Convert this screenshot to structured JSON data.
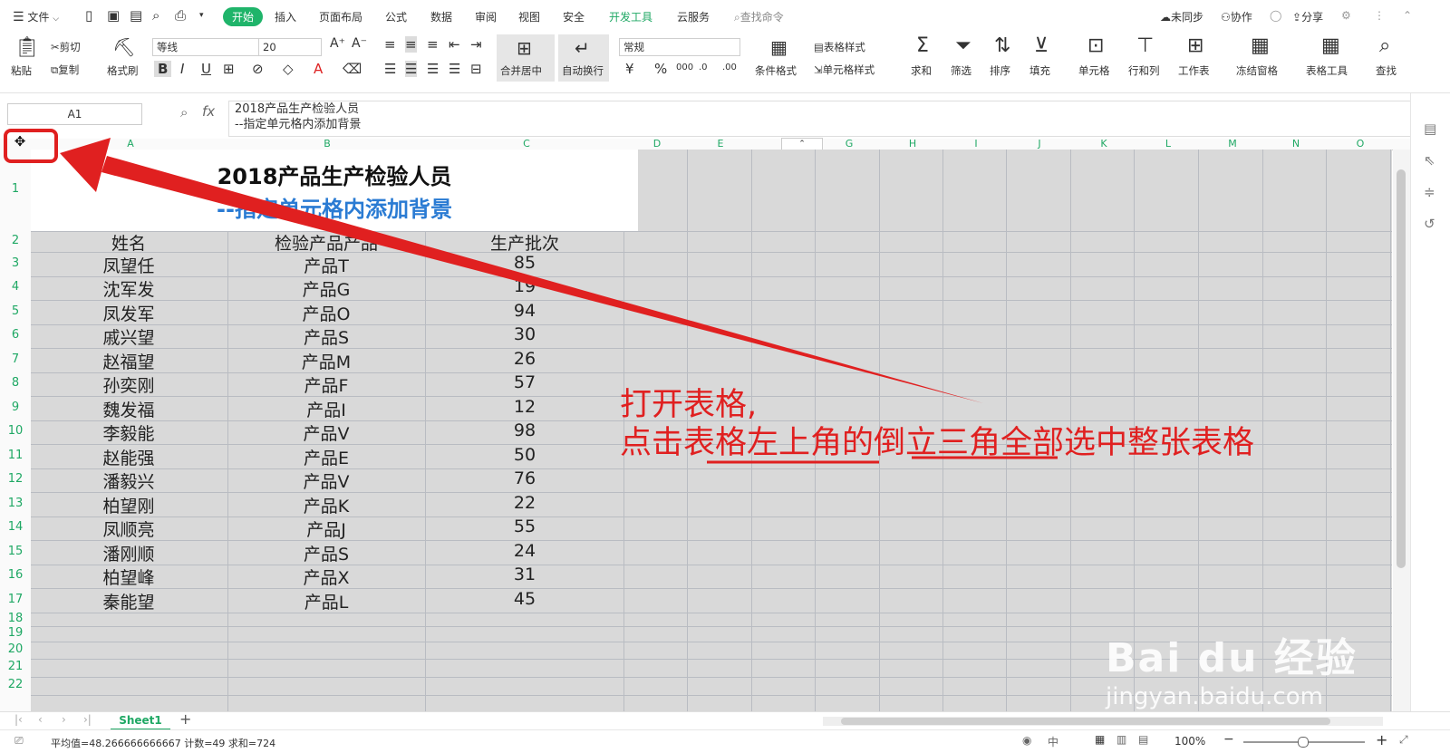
{
  "menu": {
    "file": "文件",
    "tabs": [
      "开始",
      "插入",
      "页面布局",
      "公式",
      "数据",
      "审阅",
      "视图",
      "安全",
      "开发工具",
      "云服务"
    ],
    "search": "查找命令",
    "right": [
      "未同步",
      "协作",
      "分享"
    ]
  },
  "ribbon": {
    "paste": "粘贴",
    "cut": "剪切",
    "copy": "复制",
    "format_painter": "格式刷",
    "font_name": "等线",
    "font_size": "20",
    "merge_center": "合并居中",
    "wrap": "自动换行",
    "number_format": "常规",
    "cond_format": "条件格式",
    "table_style": "表格样式",
    "cell_style": "单元格样式",
    "sum": "求和",
    "filter": "筛选",
    "sort": "排序",
    "fill": "填充",
    "cell": "单元格",
    "rowcol": "行和列",
    "worksheet": "工作表",
    "freeze": "冻结窗格",
    "table_tools": "表格工具",
    "find": "查找"
  },
  "formula_bar": {
    "name_box": "A1",
    "fx": "fx",
    "line1": "2018产品生产检验人员",
    "line2": "--指定单元格内添加背景"
  },
  "columns": [
    "A",
    "B",
    "C",
    "D",
    "E",
    "F",
    "G",
    "H",
    "I",
    "J",
    "K",
    "L",
    "M",
    "N",
    "O"
  ],
  "rows": [
    "1",
    "2",
    "3",
    "4",
    "5",
    "6",
    "7",
    "8",
    "9",
    "10",
    "11",
    "12",
    "13",
    "14",
    "15",
    "16",
    "17",
    "18",
    "19",
    "20",
    "21",
    "22"
  ],
  "sheet": {
    "title1": "2018产品生产检验人员",
    "title2": "--指定单元格内添加背景",
    "headers": [
      "姓名",
      "检验产品产品",
      "生产批次"
    ],
    "data": [
      [
        "凤望任",
        "产品T",
        "85"
      ],
      [
        "沈军发",
        "产品G",
        "19"
      ],
      [
        "凤发军",
        "产品O",
        "94"
      ],
      [
        "戚兴望",
        "产品S",
        "30"
      ],
      [
        "赵福望",
        "产品M",
        "26"
      ],
      [
        "孙奕刚",
        "产品F",
        "57"
      ],
      [
        "魏发福",
        "产品I",
        "12"
      ],
      [
        "李毅能",
        "产品V",
        "98"
      ],
      [
        "赵能强",
        "产品E",
        "50"
      ],
      [
        "潘毅兴",
        "产品V",
        "76"
      ],
      [
        "柏望刚",
        "产品K",
        "22"
      ],
      [
        "凤顺亮",
        "产品J",
        "55"
      ],
      [
        "潘刚顺",
        "产品S",
        "24"
      ],
      [
        "柏望峰",
        "产品X",
        "31"
      ],
      [
        "秦能望",
        "产品L",
        "45"
      ]
    ]
  },
  "annotation": {
    "line1": "打开表格,",
    "line2": "点击表格左上角的倒立三角全部选中整张表格",
    "color": "#e02020"
  },
  "tabs": {
    "sheet1": "Sheet1"
  },
  "status": {
    "text": "平均值=48.266666666667  计数=49  求和=724",
    "zoom": "100%"
  },
  "watermark": {
    "brand": "Bai du 经验",
    "url": "jingyan.baidu.com"
  },
  "accent": "#1fa864"
}
